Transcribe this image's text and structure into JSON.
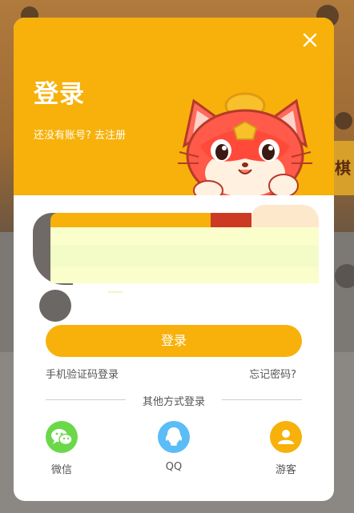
{
  "modal": {
    "title": "登录",
    "subtitle_prefix": "还没有账号?",
    "register_link": "去注册",
    "login_button": "登录",
    "phone_login_link": "手机验证码登录",
    "forgot_password_link": "忘记密码?",
    "other_methods_label": "其他方式登录",
    "social": [
      {
        "label": "微信",
        "icon": "wechat-icon",
        "color": "#6bd84a"
      },
      {
        "label": "QQ",
        "icon": "qq-icon",
        "color": "#5bbcf6"
      },
      {
        "label": "游客",
        "icon": "guest-icon",
        "color": "#f7b10a"
      }
    ]
  },
  "colors": {
    "accent": "#f7b10a",
    "text_muted": "#555555"
  }
}
